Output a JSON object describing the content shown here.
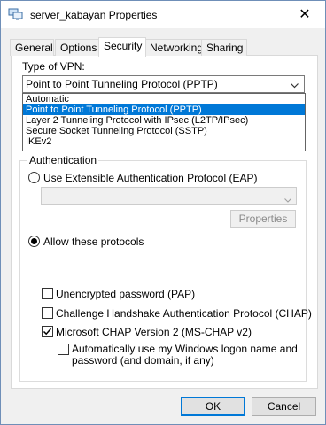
{
  "window": {
    "title": "server_kabayan Properties",
    "close_glyph": "✕"
  },
  "tabs": [
    {
      "label": "General"
    },
    {
      "label": "Options"
    },
    {
      "label": "Security"
    },
    {
      "label": "Networking"
    },
    {
      "label": "Sharing"
    }
  ],
  "vpn": {
    "label": "Type of VPN:",
    "selected": "Point to Point Tunneling Protocol (PPTP)",
    "options": [
      "Automatic",
      "Point to Point Tunneling Protocol (PPTP)",
      "Layer 2 Tunneling Protocol with IPsec (L2TP/IPsec)",
      "Secure Socket Tunneling Protocol (SSTP)",
      "IKEv2"
    ],
    "highlighted_index": 1
  },
  "auth": {
    "legend": "Authentication",
    "eap_radio": {
      "label": "Use Extensible Authentication Protocol (EAP)",
      "selected": false
    },
    "eap_select_value": "",
    "properties_button": "Properties",
    "protocols_radio": {
      "label": "Allow these protocols",
      "selected": true
    },
    "protocols": [
      {
        "label": "Unencrypted password (PAP)",
        "checked": false
      },
      {
        "label": "Challenge Handshake Authentication Protocol (CHAP)",
        "checked": false
      },
      {
        "label": "Microsoft CHAP Version 2 (MS-CHAP v2)",
        "checked": true
      }
    ],
    "auto_logon": {
      "line1": "Automatically use my Windows logon name and",
      "line2": "password (and domain, if any)",
      "checked": false
    }
  },
  "buttons": {
    "ok": "OK",
    "cancel": "Cancel"
  },
  "colors": {
    "selection": "#0078d7",
    "default_button_border": "#0078d7"
  }
}
